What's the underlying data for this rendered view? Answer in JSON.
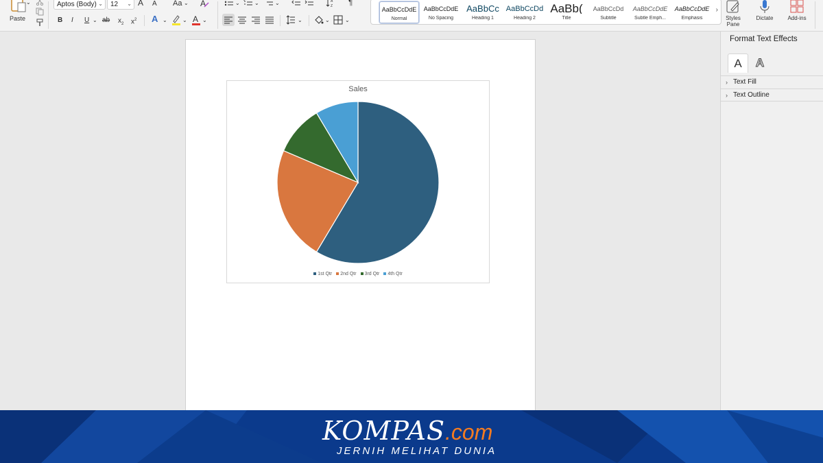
{
  "ribbon": {
    "paste_label": "Paste",
    "font_name": "Aptos (Body)",
    "font_size": "12",
    "case_label": "Aa",
    "grow_font": "A",
    "shrink_font": "A",
    "bold": "B",
    "italic": "I",
    "underline": "U",
    "strikethrough": "ab",
    "subscript": "x",
    "superscript": "x",
    "font_color_glyph": "A",
    "text_effects_glyph": "A",
    "pilcrow": "¶",
    "styles": [
      {
        "preview": "AaBbCcDdE",
        "name": "Normal"
      },
      {
        "preview": "AaBbCcDdE",
        "name": "No Spacing"
      },
      {
        "preview": "AaBbCc",
        "name": "Heading 1"
      },
      {
        "preview": "AaBbCcDd",
        "name": "Heading 2"
      },
      {
        "preview": "AaBb(",
        "name": "Title"
      },
      {
        "preview": "AaBbCcDd",
        "name": "Subtitle"
      },
      {
        "preview": "AaBbCcDdE",
        "name": "Subtle Emph..."
      },
      {
        "preview": "AaBbCcDdE",
        "name": "Emphasis"
      }
    ],
    "styles_pane_label": "Styles Pane",
    "dictate_label": "Dictate",
    "addins_label": "Add-ins",
    "colors": {
      "highlight": "#f5e52a",
      "font_color": "#e0342c",
      "text_effect": "#3a6fc4"
    }
  },
  "chart_data": {
    "type": "pie",
    "title": "Sales",
    "categories": [
      "1st Qtr",
      "2nd Qtr",
      "3rd Qtr",
      "4th Qtr"
    ],
    "values": [
      8.2,
      3.2,
      1.4,
      1.2
    ],
    "colors": [
      "#2e5f7f",
      "#d9773f",
      "#346a2e",
      "#4a9fd4"
    ],
    "legend_position": "bottom"
  },
  "pane": {
    "title": "Format Text Effects",
    "tab_text_glyph": "A",
    "tab_effects_glyph": "A",
    "sections": [
      {
        "label": "Text Fill"
      },
      {
        "label": "Text Outline"
      }
    ]
  },
  "banner": {
    "brand_main": "KOMPAS",
    "brand_suffix": ".com",
    "tagline": "JERNIH MELIHAT DUNIA"
  }
}
